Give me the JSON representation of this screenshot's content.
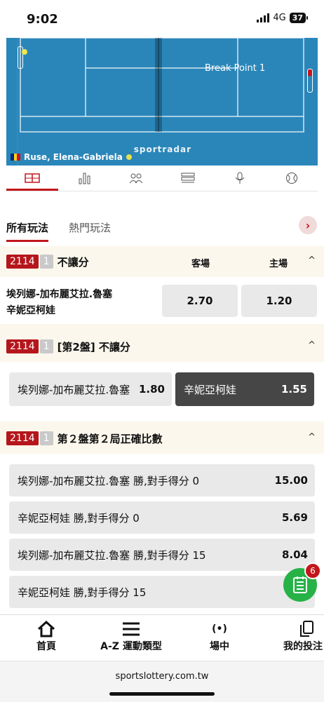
{
  "status": {
    "time": "9:02",
    "network": "4G",
    "battery": "37"
  },
  "scoreboard": {
    "event": "Break Point 1",
    "player": "Ruse, Elena-Gabriela",
    "provider": "sportradar"
  },
  "tabs": [
    {
      "icon": "court-icon",
      "active": true
    },
    {
      "icon": "stats-icon"
    },
    {
      "icon": "players-icon"
    },
    {
      "icon": "list-icon"
    },
    {
      "icon": "microphone-icon"
    },
    {
      "icon": "tennis-ball-icon"
    }
  ],
  "market_tabs": {
    "all": "所有玩法",
    "hot": "熱門玩法"
  },
  "sections": [
    {
      "code": "2114",
      "num": "1",
      "title": "不讓分",
      "col_away": "客場",
      "col_home": "主場",
      "team1": "埃列娜-加布麗艾拉.魯塞",
      "team2": "辛妮亞柯娃",
      "odds_away": "2.70",
      "odds_home": "1.20"
    },
    {
      "code": "2114",
      "num": "1",
      "title": "[第2盤] 不讓分",
      "left_label": "埃列娜-加布麗艾拉.魯塞",
      "left_odd": "1.80",
      "right_label": "辛妮亞柯娃",
      "right_odd": "1.55"
    },
    {
      "code": "2114",
      "num": "1",
      "title": "第２盤第２局正確比數",
      "rows": [
        {
          "label": "埃列娜-加布麗艾拉.魯塞 勝,對手得分 0",
          "odd": "15.00"
        },
        {
          "label": "辛妮亞柯娃 勝,對手得分 0",
          "odd": "5.69"
        },
        {
          "label": "埃列娜-加布麗艾拉.魯塞 勝,對手得分 15",
          "odd": "8.04"
        },
        {
          "label": "辛妮亞柯娃 勝,對手得分 15",
          "odd": ""
        }
      ]
    }
  ],
  "betslip_count": "6",
  "bottom_nav": {
    "home": "首頁",
    "az": "A-Z 運動類型",
    "live": "場中",
    "mybets": "我的投注"
  },
  "url": "sportslottery.com.tw",
  "colors": {
    "accent": "#c3161c",
    "badge": "#b5161c",
    "court": "#2a86b9",
    "section_bg": "#fbf7ec",
    "fab": "#27b248"
  }
}
